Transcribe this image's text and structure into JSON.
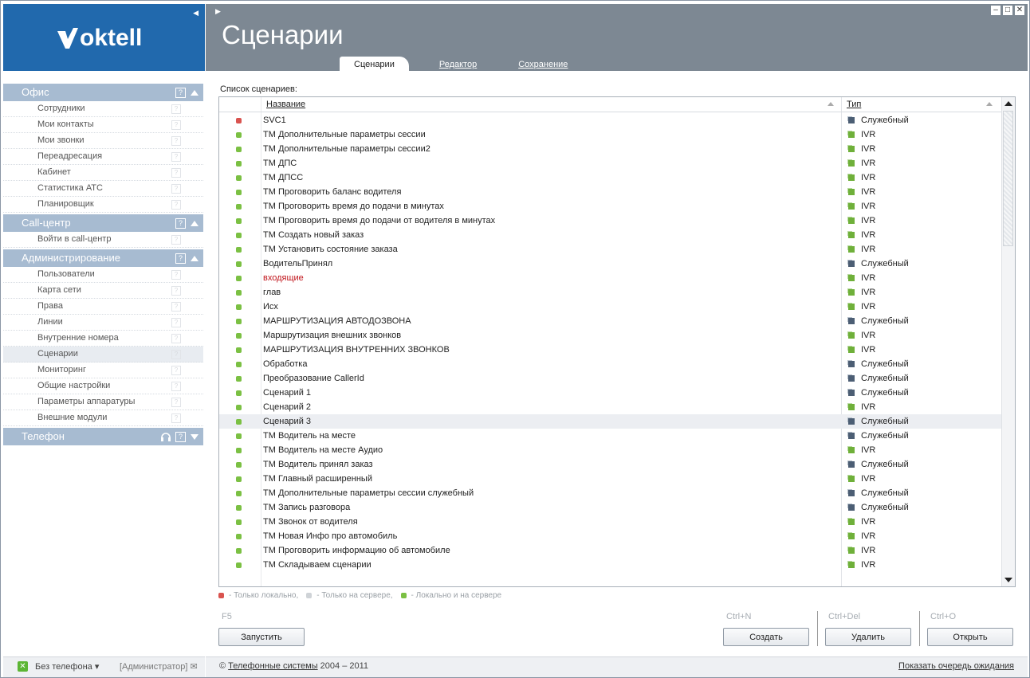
{
  "brand": {
    "logo_text": "oktell"
  },
  "header": {
    "title": "Сценарии",
    "tabs": [
      {
        "label": "Сценарии",
        "active": true
      },
      {
        "label": "Редактор",
        "active": false
      },
      {
        "label": "Сохранение",
        "active": false
      }
    ]
  },
  "sidebar": {
    "groups": [
      {
        "label": "Офис",
        "items": [
          "Сотрудники",
          "Мои контакты",
          "Мои звонки",
          "Переадресация",
          "Кабинет",
          "Статистика АТС",
          "Планировщик"
        ]
      },
      {
        "label": "Call-центр",
        "items": [
          "Войти в call-центр"
        ]
      },
      {
        "label": "Администрирование",
        "items": [
          "Пользователи",
          "Карта сети",
          "Права",
          "Линии",
          "Внутренние номера",
          "Сценарии",
          "Мониторинг",
          "Общие настройки",
          "Параметры аппаратуры",
          "Внешние модули"
        ]
      },
      {
        "label": "Телефон",
        "items": []
      }
    ],
    "selected_item": "Сценарии"
  },
  "status_left": {
    "phone": "Без телефона",
    "user": "[Администратор]"
  },
  "main": {
    "list_label": "Список сценариев:",
    "columns": {
      "name": "Название",
      "type": "Тип"
    },
    "rows": [
      {
        "name": "SVC1",
        "type": "Служебный",
        "status": "local"
      },
      {
        "name": "ТМ Дополнительные параметры сессии",
        "type": "IVR",
        "status": "both"
      },
      {
        "name": "ТМ Дополнительные параметры сессии2",
        "type": "IVR",
        "status": "both"
      },
      {
        "name": "ТМ ДПС",
        "type": "IVR",
        "status": "both"
      },
      {
        "name": "ТМ ДПСС",
        "type": "IVR",
        "status": "both"
      },
      {
        "name": "ТМ Проговорить баланс водителя",
        "type": "IVR",
        "status": "both"
      },
      {
        "name": "ТМ Проговорить время до подачи в минутах",
        "type": "IVR",
        "status": "both"
      },
      {
        "name": "ТМ Проговорить время до подачи от водителя в минутах",
        "type": "IVR",
        "status": "both"
      },
      {
        "name": "ТМ Создать новый заказ",
        "type": "IVR",
        "status": "both"
      },
      {
        "name": "ТМ Установить состояние заказа",
        "type": "IVR",
        "status": "both"
      },
      {
        "name": "ВодительПринял",
        "type": "Служебный",
        "status": "both"
      },
      {
        "name": "входящие",
        "type": "IVR",
        "status": "both",
        "highlight": true
      },
      {
        "name": "глав",
        "type": "IVR",
        "status": "both"
      },
      {
        "name": "Исх",
        "type": "IVR",
        "status": "both"
      },
      {
        "name": "МАРШРУТИЗАЦИЯ АВТОДОЗВОНА",
        "type": "Служебный",
        "status": "both"
      },
      {
        "name": "Маршрутизация внешних звонков",
        "type": "IVR",
        "status": "both"
      },
      {
        "name": "МАРШРУТИЗАЦИЯ ВНУТРЕННИХ ЗВОНКОВ",
        "type": "IVR",
        "status": "both"
      },
      {
        "name": "Обработка",
        "type": "Служебный",
        "status": "both"
      },
      {
        "name": "Преобразование CallerId",
        "type": "Служебный",
        "status": "both"
      },
      {
        "name": "Сценарий 1",
        "type": "Служебный",
        "status": "both"
      },
      {
        "name": "Сценарий 2",
        "type": "IVR",
        "status": "both"
      },
      {
        "name": "Сценарий 3",
        "type": "Служебный",
        "status": "both",
        "selected": true
      },
      {
        "name": "ТМ Водитель на месте",
        "type": "Служебный",
        "status": "both"
      },
      {
        "name": "ТМ Водитель на месте Аудио",
        "type": "IVR",
        "status": "both"
      },
      {
        "name": "ТМ Водитель принял заказ",
        "type": "Служебный",
        "status": "both"
      },
      {
        "name": "ТМ Главный расширенный",
        "type": "IVR",
        "status": "both"
      },
      {
        "name": "ТМ Дополнительные параметры сессии служебный",
        "type": "Служебный",
        "status": "both"
      },
      {
        "name": "ТМ Запись разговора",
        "type": "Служебный",
        "status": "both"
      },
      {
        "name": "ТМ Звонок от водителя",
        "type": "IVR",
        "status": "both"
      },
      {
        "name": "ТМ Новая Инфо про автомобиль",
        "type": "IVR",
        "status": "both"
      },
      {
        "name": "ТМ Проговорить информацию об автомобиле",
        "type": "IVR",
        "status": "both"
      },
      {
        "name": "ТМ Складываем сценарии",
        "type": "IVR",
        "status": "both"
      }
    ],
    "legend": [
      {
        "label": "- Только локально,",
        "color": "#d9534f"
      },
      {
        "label": "- Только на сервере,",
        "color": "#cfd3d7"
      },
      {
        "label": "- Локально и на сервере",
        "color": "#7bc043"
      }
    ],
    "actions": {
      "run": {
        "hotkey": "F5",
        "label": "Запустить"
      },
      "create": {
        "hotkey": "Ctrl+N",
        "label": "Создать"
      },
      "delete": {
        "hotkey": "Ctrl+Del",
        "label": "Удалить"
      },
      "open": {
        "hotkey": "Ctrl+O",
        "label": "Открыть"
      }
    }
  },
  "footer": {
    "copyright_symbol": "©",
    "company_link": "Телефонные системы",
    "years": "2004 – 2011",
    "queue_link": "Показать очередь ожидания"
  },
  "colors": {
    "accent": "#2169ad",
    "header": "#7d8893",
    "group": "#a7bbd1",
    "ivr": "#6fb03a",
    "service": "#4c5e74"
  }
}
